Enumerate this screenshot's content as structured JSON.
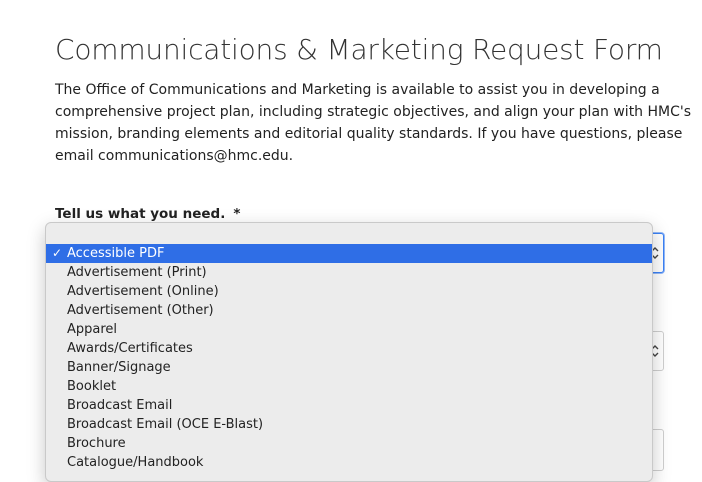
{
  "page": {
    "title": "Communications & Marketing Request Form",
    "intro_lines": [
      "The Office of Communications and Marketing is available to assist you in developing a",
      "comprehensive project plan, including strategic objectives, and align your plan with HMC's",
      "mission, branding elements and editorial quality standards. If you have questions, please",
      "email communications@hmc.edu."
    ]
  },
  "form": {
    "need_field": {
      "label": "Tell us what you need.",
      "required_marker": "*",
      "selected_value": "Accessible PDF",
      "check_glyph": "✓",
      "options": [
        "Accessible PDF",
        "Advertisement (Print)",
        "Advertisement (Online)",
        "Advertisement (Other)",
        "Apparel",
        "Awards/Certificates",
        "Banner/Signage",
        "Booklet",
        "Broadcast Email",
        "Broadcast Email (OCE E-Blast)",
        "Brochure",
        "Catalogue/Handbook"
      ]
    }
  },
  "colors": {
    "selection": "#2f6ee6",
    "focus_ring": "#3b82f6",
    "menu_background": "#ececec"
  },
  "icons": {
    "selected_marker": "check-icon",
    "select_stepper": "chevron-updown-icon"
  }
}
